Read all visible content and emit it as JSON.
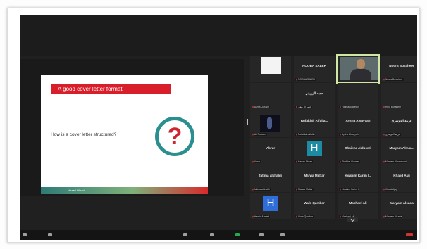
{
  "slide": {
    "title": "A good cover letter format",
    "question": "How is a cover letter structured?",
    "question_mark": "?",
    "footer": "Hazart Oleart"
  },
  "colors": {
    "slide_title_bg": "#d81e2a",
    "circle_border": "#2a8f8e",
    "question_mark": "#cf2530",
    "avatar_teal": "#1b8ca3",
    "avatar_blue": "#2f6ed8"
  },
  "participants": [
    {
      "name": "",
      "sub": "",
      "type": "white-video"
    },
    {
      "name": "NOOBA SALEH",
      "sub": "NOOBA SALEH",
      "type": "name"
    },
    {
      "name": "",
      "sub": "",
      "type": "video-man",
      "active": true
    },
    {
      "name": "Noora Busaheer",
      "sub": "Noora Busaheer",
      "type": "name"
    },
    {
      "name": "",
      "sub": "Asma Qassim",
      "type": "blank"
    },
    {
      "name": "حصه الزريقي",
      "sub": "حصه الزريقي",
      "type": "name"
    },
    {
      "name": "",
      "sub": "Fatima Alaaeldin",
      "type": "blank"
    },
    {
      "name": "",
      "sub": "Hind Busaheer",
      "type": "blank"
    },
    {
      "name": "",
      "sub": "Ali Ruhaimi",
      "type": "video-stage"
    },
    {
      "name": "Rufaidah Alfulla...",
      "sub": "Rufaidah Alfulla",
      "type": "name"
    },
    {
      "name": "Aysha Alsayyah",
      "sub": "Aysha Alsayyah",
      "type": "name"
    },
    {
      "name": "غريبة الدوسري",
      "sub": "غريبة الدوسري",
      "type": "name"
    },
    {
      "name": "Abrar",
      "sub": "Abrar",
      "type": "name"
    },
    {
      "name": "",
      "sub": "Hanan Abbas",
      "type": "avatar",
      "initial": "H"
    },
    {
      "name": "Shaikha Alduseri",
      "sub": "Shaikha Alduseri",
      "type": "name"
    },
    {
      "name": "Maryam Almar...",
      "sub": "Maryam Almansoori",
      "type": "name"
    },
    {
      "name": "fatima alkhaldi",
      "sub": "fatima alkhaldi",
      "type": "name"
    },
    {
      "name": "Marwa Mattar",
      "sub": "Marwa Mattar",
      "type": "name"
    },
    {
      "name": "ebrahim Karim I...",
      "sub": "ebrahim Karim I",
      "type": "name"
    },
    {
      "name": "Khalid Ajaj",
      "sub": "Khalid Ajaj",
      "type": "name"
    },
    {
      "name": "",
      "sub": "Hamid Ahmed",
      "type": "avatar",
      "initial": "H"
    },
    {
      "name": "Wafa Qambar",
      "sub": "Wafa Qambar",
      "type": "name"
    },
    {
      "name": "Mashael Ali",
      "sub": "Mashael Ali",
      "type": "name"
    },
    {
      "name": "Maryam Alsada",
      "sub": "Maryam Alsada",
      "type": "name"
    }
  ]
}
